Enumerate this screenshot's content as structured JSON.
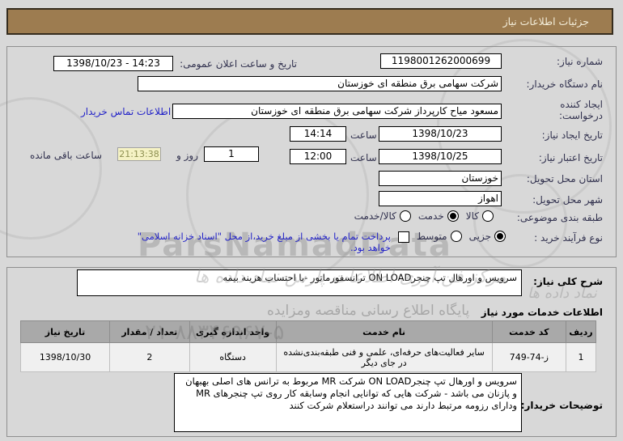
{
  "page": {
    "title": "جزئیات اطلاعات نیاز"
  },
  "form": {
    "need_number": {
      "label": "شماره نیاز:",
      "value": "1198001262000699"
    },
    "announce": {
      "label": "تاریخ و ساعت اعلان عمومی:",
      "value": "1398/10/23 - 14:23"
    },
    "buyer_org": {
      "label": "نام دستگاه خریدار:",
      "value": "شرکت سهامی برق منطقه ای خوزستان"
    },
    "creator": {
      "label": "ایجاد کننده درخواست:",
      "value": "مسعود میاح کارپرداز شرکت سهامی برق منطقه ای خوزستان"
    },
    "contact_link": "اطلاعات تماس خریدار",
    "create_date": {
      "label": "تاریخ ایجاد نیاز:",
      "date": "1398/10/23",
      "hour_label": "ساعت",
      "time": "14:14"
    },
    "expire_date": {
      "label": "تاریخ اعتبار نیاز:",
      "date": "1398/10/25",
      "hour_label": "ساعت",
      "time": "12:00"
    },
    "remaining": {
      "days": "1",
      "days_label": "روز و",
      "timer": "21:13:38",
      "suffix_label": "ساعت باقی مانده"
    },
    "province": {
      "label": "استان محل تحویل:",
      "value": "خوزستان"
    },
    "city": {
      "label": "شهر محل تحویل:",
      "value": "اهواز"
    },
    "subject_class": {
      "label": "طبقه بندی موضوعی:",
      "options": [
        {
          "label": "کالا",
          "checked": false
        },
        {
          "label": "خدمت",
          "checked": true
        },
        {
          "label": "کالا/خدمت",
          "checked": false
        }
      ]
    },
    "purchase_type": {
      "label": "نوع فرآیند خرید :",
      "options": [
        {
          "label": "جزیی",
          "checked": true
        },
        {
          "label": "متوسط",
          "checked": false
        }
      ],
      "treasury_note": "پرداخت تمام یا بخشی از مبلغ خرید،از محل \"اسناد خزانه اسلامی\" خواهد بود."
    }
  },
  "description": {
    "label": "شرح کلی نیاز:",
    "value": "سرویس و اورهال تپ چنجرON LOAD ترانسفورماتور -با احتساب هزینه بیمه"
  },
  "services": {
    "title": "اطلاعات خدمات مورد نیاز",
    "headers": [
      "ردیف",
      "کد خدمت",
      "نام خدمت",
      "واحد اندازه گیری",
      "تعداد / مقدار",
      "تاریخ نیاز"
    ],
    "rows": [
      {
        "row": "1",
        "code": "749-74-ز",
        "name": "سایر فعالیت‌های حرفه‌ای، علمی و فنی طبقه‌بندی‌نشده در جای دیگر",
        "unit": "دستگاه",
        "qty": "2",
        "date": "1398/10/30"
      }
    ]
  },
  "buyer_notes": {
    "label": "توضیحات خریدار:",
    "value": "سرویس و اورهال تپ چنجرON LOAD شرکت MR مربوط به ترانس های اصلی بهبهان و پازنان می باشد - شرکت هایی که توانایی انجام وسابقه کار روی تپ چنجرهای MR ودارای رزومه مرتبط دارند می توانند دراستعلام شرکت کنند"
  },
  "watermarks": {
    "latin": "ParsNamadData",
    "portal": "پایگاه اطلاع رسانی مناقصه ومزایده",
    "agency": "مرکز فن آوری اطلاعات پارس نماد داده ها",
    "brand": "نماد داده ها",
    "phone": "۰۲۱-۸۸۳۴۶۹۶۷-۵"
  },
  "colors": {
    "titlebar_bg": "#9d7c50",
    "page_bg": "#d8d8d8",
    "link_blue": "#2323c8",
    "timer_bg": "#f5f2c4",
    "table_header_bg": "#a9a9a9"
  }
}
